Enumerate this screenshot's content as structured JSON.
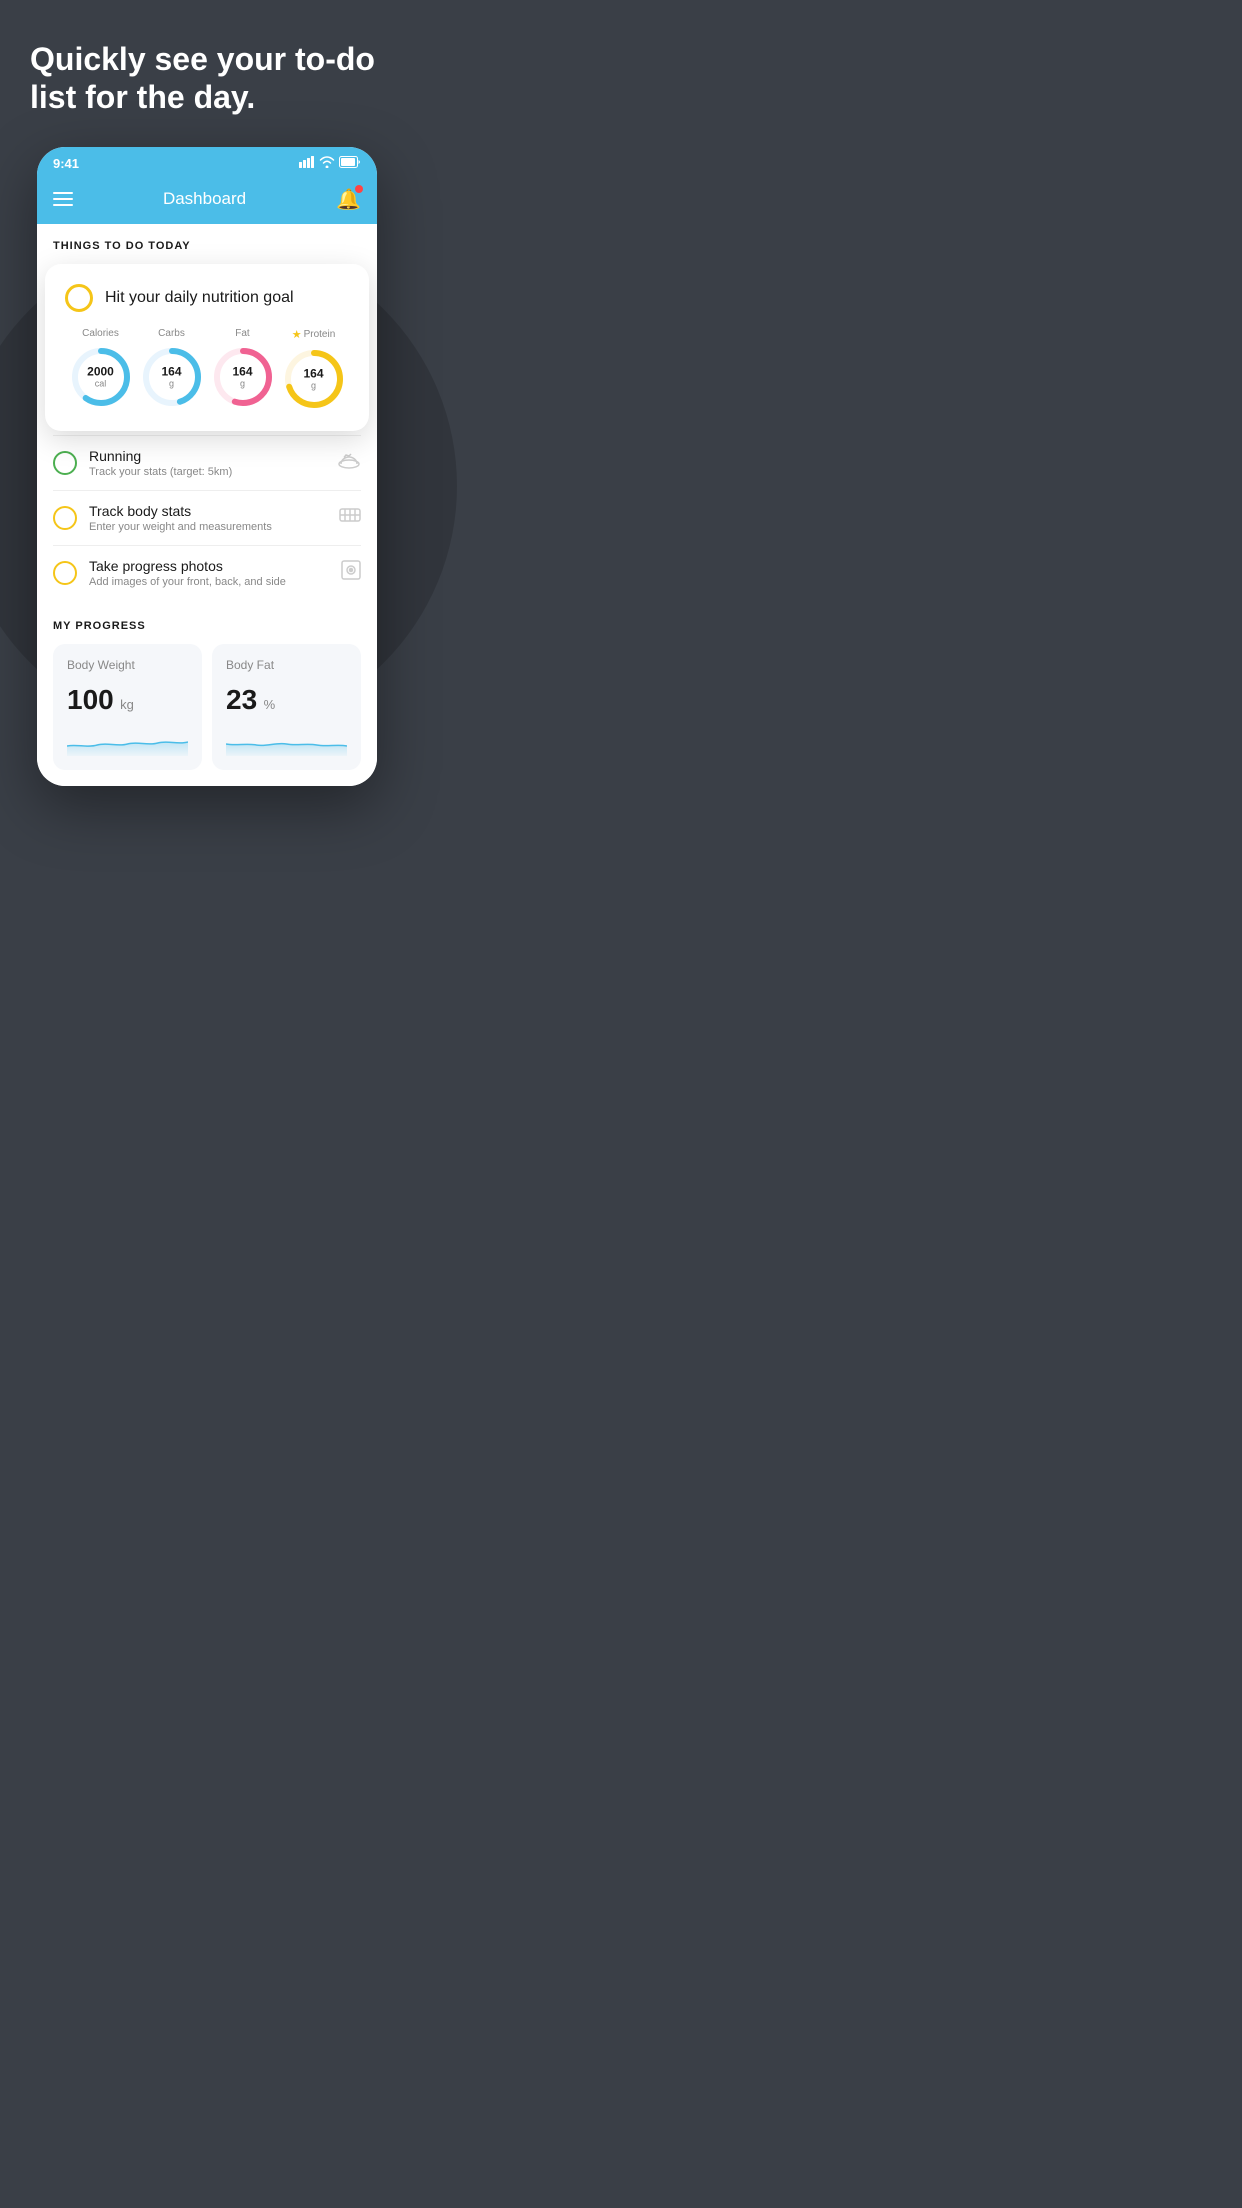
{
  "hero": {
    "title": "Quickly see your to-do list for the day."
  },
  "status_bar": {
    "time": "9:41",
    "signal": "▋▋▋▋",
    "wifi": "wifi",
    "battery": "battery"
  },
  "nav": {
    "title": "Dashboard"
  },
  "things_section": {
    "title": "THINGS TO DO TODAY"
  },
  "nutrition_card": {
    "title": "Hit your daily nutrition goal",
    "items": [
      {
        "label": "Calories",
        "value": "2000",
        "unit": "cal",
        "color": "#4bbde8",
        "progress": 60
      },
      {
        "label": "Carbs",
        "value": "164",
        "unit": "g",
        "color": "#4bbde8",
        "progress": 45
      },
      {
        "label": "Fat",
        "value": "164",
        "unit": "g",
        "color": "#f06292",
        "progress": 55
      },
      {
        "label": "Protein",
        "value": "164",
        "unit": "g",
        "color": "#f5c518",
        "progress": 70,
        "starred": true
      }
    ]
  },
  "todo_items": [
    {
      "title": "Running",
      "subtitle": "Track your stats (target: 5km)",
      "circle_color": "green",
      "icon": "👟"
    },
    {
      "title": "Track body stats",
      "subtitle": "Enter your weight and measurements",
      "circle_color": "yellow",
      "icon": "⚖"
    },
    {
      "title": "Take progress photos",
      "subtitle": "Add images of your front, back, and side",
      "circle_color": "yellow",
      "icon": "👤"
    }
  ],
  "progress_section": {
    "title": "MY PROGRESS",
    "cards": [
      {
        "title": "Body Weight",
        "value": "100",
        "unit": "kg"
      },
      {
        "title": "Body Fat",
        "value": "23",
        "unit": "%"
      }
    ]
  }
}
